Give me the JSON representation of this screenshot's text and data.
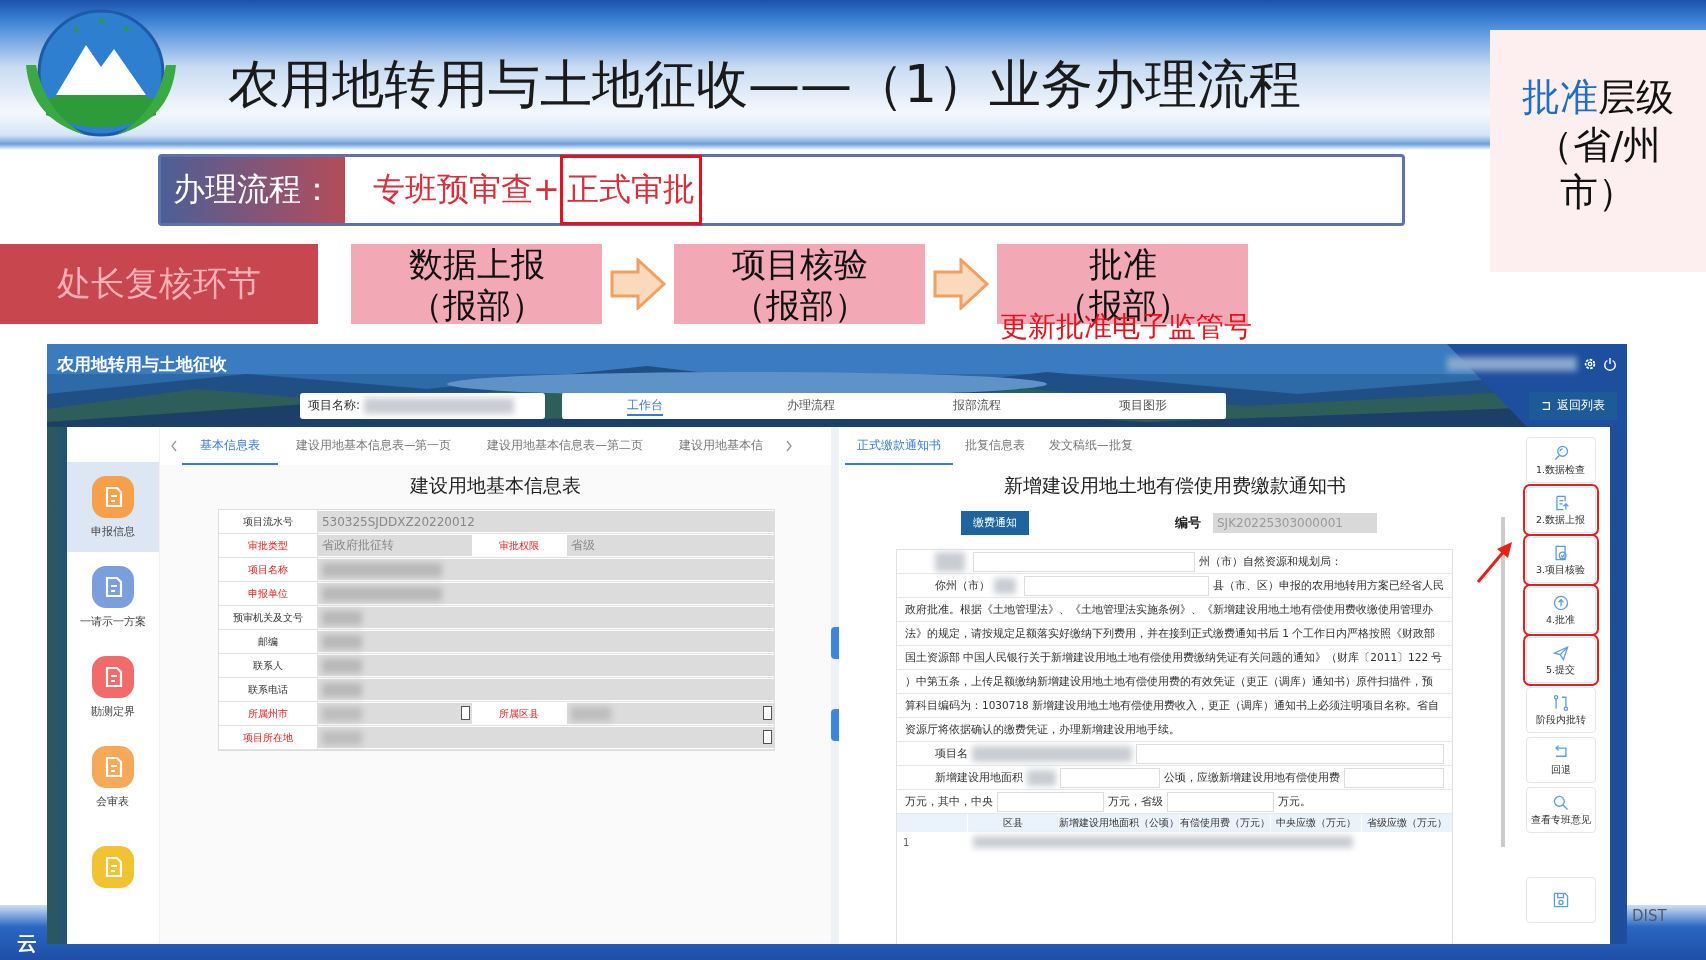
{
  "slide": {
    "title": "农用地转用与土地征收——（1）业务办理流程",
    "level_note": {
      "highlight": "批准",
      "text": "层级（省/州市）"
    },
    "process": {
      "label": "办理流程：",
      "text": "专班预审查+",
      "boxed": "正式审批"
    },
    "stage": "处长复核环节",
    "steps": [
      {
        "title": "数据上报",
        "sub": "（报部）"
      },
      {
        "title": "项目核验",
        "sub": "（报部）"
      },
      {
        "title": "批准",
        "sub": "（报部）"
      }
    ],
    "step_note": "更新批准电子监管号",
    "footer_text": "云",
    "footer_mark": "DIST"
  },
  "app": {
    "title": "农用地转用与土地征收",
    "search": {
      "label": "项目名称:"
    },
    "nav_tabs": [
      {
        "label": "工作台",
        "selected": true
      },
      {
        "label": "办理流程",
        "selected": false
      },
      {
        "label": "报部流程",
        "selected": false
      },
      {
        "label": "项目图形",
        "selected": false
      }
    ],
    "back_button": "返回列表",
    "sidebar": [
      {
        "label": "申报信息",
        "selected": true,
        "color": "#f6a04a"
      },
      {
        "label": "一请示一方案",
        "selected": false,
        "color": "#7b9fdc"
      },
      {
        "label": "勘测定界",
        "selected": false,
        "color": "#f26b6b"
      },
      {
        "label": "会审表",
        "selected": false,
        "color": "#f7a95a"
      },
      {
        "selected": false,
        "color": "#f1c232"
      }
    ],
    "left_tabs": [
      {
        "label": "基本信息表",
        "selected": true
      },
      {
        "label": "建设用地基本信息表—第一页",
        "selected": false
      },
      {
        "label": "建设用地基本信息表—第二页",
        "selected": false
      },
      {
        "label": "建设用地基本信",
        "selected": false
      }
    ],
    "form": {
      "title": "建设用地基本信息表",
      "rows": [
        {
          "kind": "text",
          "label": "项目流水号",
          "required": false,
          "value": "530325SJDDXZ20220012"
        },
        {
          "kind": "pair",
          "label": "审批类型",
          "required": true,
          "value": "省政府批征转",
          "label2": "审批权限",
          "value2": "省级"
        },
        {
          "kind": "redacted",
          "label": "项目名称",
          "required": true
        },
        {
          "kind": "redacted",
          "label": "申报单位",
          "required": true
        },
        {
          "kind": "redacted",
          "label": "预审机关及文号",
          "required": false
        },
        {
          "kind": "redacted",
          "label": "邮编",
          "required": false
        },
        {
          "kind": "redacted",
          "label": "联系人",
          "required": false
        },
        {
          "kind": "redacted",
          "label": "联系电话",
          "required": false
        },
        {
          "kind": "select_pair",
          "label": "所属州市",
          "required": true,
          "label2": "所属区县"
        },
        {
          "kind": "select",
          "label": "项目所在地",
          "required": true
        }
      ]
    },
    "right_tabs": [
      {
        "label": "正式缴款通知书",
        "selected": true
      },
      {
        "label": "批复信息表",
        "selected": false
      },
      {
        "label": "发文稿纸—批复",
        "selected": false
      }
    ],
    "notice": {
      "title": "新增建设用地土地有偿使用费缴款通知书",
      "button": "缴费通知",
      "number_label": "编号",
      "number": "SJK20225303000001",
      "line1": "州（市）自然资源和规划局：",
      "line2_prefix": "你州（市）",
      "line2": "县（市、区）申报的农用地转用方案已经省人民",
      "paragraph": [
        "政府批准。根据《土地管理法》、《土地管理法实施条例》、《新增建设用地土地有偿使用费收缴使用管理办",
        "法》的规定，请按规定足额落实好缴纳下列费用，并在接到正式缴费通知书后 1 个工作日内严格按照《财政部",
        "国土资源部 中国人民银行关于新增建设用地土地有偿使用费缴纳凭证有关问题的通知》（财库〔2011〕122 号",
        "）中第五条，上传足额缴纳新增建设用地土地有偿使用费的有效凭证（更正（调库）通知书）原件扫描件，预",
        "算科目编码为：1030718 新增建设用地土地有偿使用费收入，更正（调库）通知书上必须注明项目名称。省自",
        "资源厅将依据确认的缴费凭证，办理新增建设用地手续。"
      ],
      "name_label": "项目名",
      "area_label": "新增建设用地面积",
      "area_unit": "公顷，应缴新增建设用地有偿使用费",
      "split": [
        "万元，其中，中央",
        "万元，省级",
        "万元。"
      ],
      "columns": [
        "区县",
        "新增建设用地面积（公顷）",
        "有偿使用费（万元）",
        "中央应缴（万元）",
        "省级应缴（万元）"
      ],
      "rows": [
        "1"
      ]
    },
    "actions": [
      {
        "label": "1.数据检查",
        "highlighted": false
      },
      {
        "label": "2.数据上报",
        "highlighted": true
      },
      {
        "label": "3.项目核验",
        "highlighted": true
      },
      {
        "label": "4.批准",
        "highlighted": true
      },
      {
        "label": "5.提交",
        "highlighted": true
      },
      {
        "label": "阶段内批转",
        "highlighted": false
      },
      {
        "label": "回退",
        "highlighted": false
      },
      {
        "label": "查看专班意见",
        "highlighted": false
      }
    ]
  }
}
